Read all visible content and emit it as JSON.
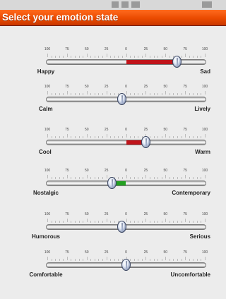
{
  "header": {
    "title": "Select your emotion state"
  },
  "scale": [
    "100",
    "75",
    "50",
    "25",
    "0",
    "25",
    "50",
    "75",
    "100"
  ],
  "colors": {
    "header": "#ea4a00",
    "negative_fill": "#c0141a",
    "positive_fill": "#22a020"
  },
  "sliders": [
    {
      "left_label": "Happy",
      "right_label": "Sad",
      "value": 65,
      "fill_color": "#c0141a"
    },
    {
      "left_label": "Calm",
      "right_label": "Lively",
      "value": -5,
      "fill_color": ""
    },
    {
      "left_label": "Cool",
      "right_label": "Warm",
      "value": 25,
      "fill_color": "#c0141a"
    },
    {
      "left_label": "Nostalgic",
      "right_label": "Contemporary",
      "value": -18,
      "fill_color": "#22a020"
    },
    {
      "left_label": "Humorous",
      "right_label": "Serious",
      "value": -5,
      "fill_color": ""
    },
    {
      "left_label": "Comfortable",
      "right_label": "Uncomfortable",
      "value": 0,
      "fill_color": ""
    }
  ]
}
